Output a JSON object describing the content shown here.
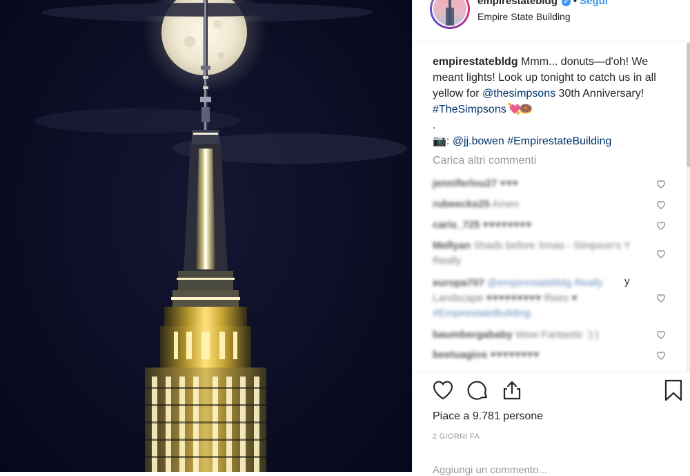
{
  "post": {
    "username": "empirestatebldg",
    "verified_glyph": "✔",
    "separator": "•",
    "follow_label": "Segui",
    "location": "Empire State Building"
  },
  "caption": {
    "username": "empirestatebldg",
    "text_1": " Mmm... donuts—d'oh! We meant lights! Look up tonight to catch us in all yellow for ",
    "mention": "@thesimpsons",
    "text_2": " 30th Anniversary! ",
    "hashtag": "#TheSimpsons",
    "emoji": " 💘🍩",
    "dot": ".",
    "camera": "📷",
    "credit_colon": ": ",
    "credit_mention": "@jj.bowen",
    "credit_hashtag": " #EmpirestateBuilding"
  },
  "load_more_label": "Carica altri commenti",
  "comments": [
    {
      "user": "jenniferlou27",
      "text": "♥♥♥"
    },
    {
      "user": "rubeecks25",
      "text": "Amen"
    },
    {
      "user": "caris_725",
      "text": "♥♥♥♥♥♥♥♥"
    },
    {
      "user": "Mellyan",
      "text": "Shads before Xmas - Simpson's Y Really"
    },
    {
      "user": "europa707",
      "text": "@empirestatebldg Really",
      "extra": "Landscape ♥♥♥♥♥♥♥♥♥ Rees ♥",
      "tag": "#EmpirestateBuilding",
      "tail": "y"
    },
    {
      "user": "baumbergababy",
      "text": "Wow Fantastic :):)"
    },
    {
      "user": "beetuagios",
      "text": "♥♥♥♥♥♥♥♥"
    }
  ],
  "likes": {
    "prefix": "Piace a ",
    "count": "9.781",
    "suffix": " persone"
  },
  "time_ago": "2 GIORNI FA",
  "add_comment_placeholder": "Aggiungi un commento..."
}
